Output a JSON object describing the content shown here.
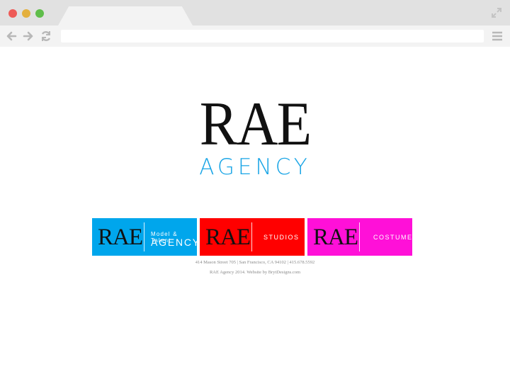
{
  "browser": {
    "icons": {
      "back": "arrow-left-icon",
      "forward": "arrow-right-icon",
      "reload": "reload-icon",
      "menu": "hamburger-menu-icon",
      "expand": "expand-icon"
    },
    "url": ""
  },
  "logo": {
    "main": "RAE",
    "sub": "AGENCY"
  },
  "tiles": [
    {
      "brand": "RAE",
      "small": "Model & Talent",
      "big": "AGENCY",
      "color": "#00a6ec"
    },
    {
      "brand": "RAE",
      "label": "STUDIOS",
      "color": "#ff0000"
    },
    {
      "brand": "RAE",
      "label": "COSTUMES",
      "color": "#ff10d8"
    }
  ],
  "footer": {
    "address": "414 Mason Street 705 | San Francisco, CA 94102 | 415.678.5592",
    "credit": "RAE Agency 2014. Website by BrytDesigns.com"
  },
  "colors": {
    "accent": "#1aa5e6",
    "chrome": "#e1e1e1"
  }
}
